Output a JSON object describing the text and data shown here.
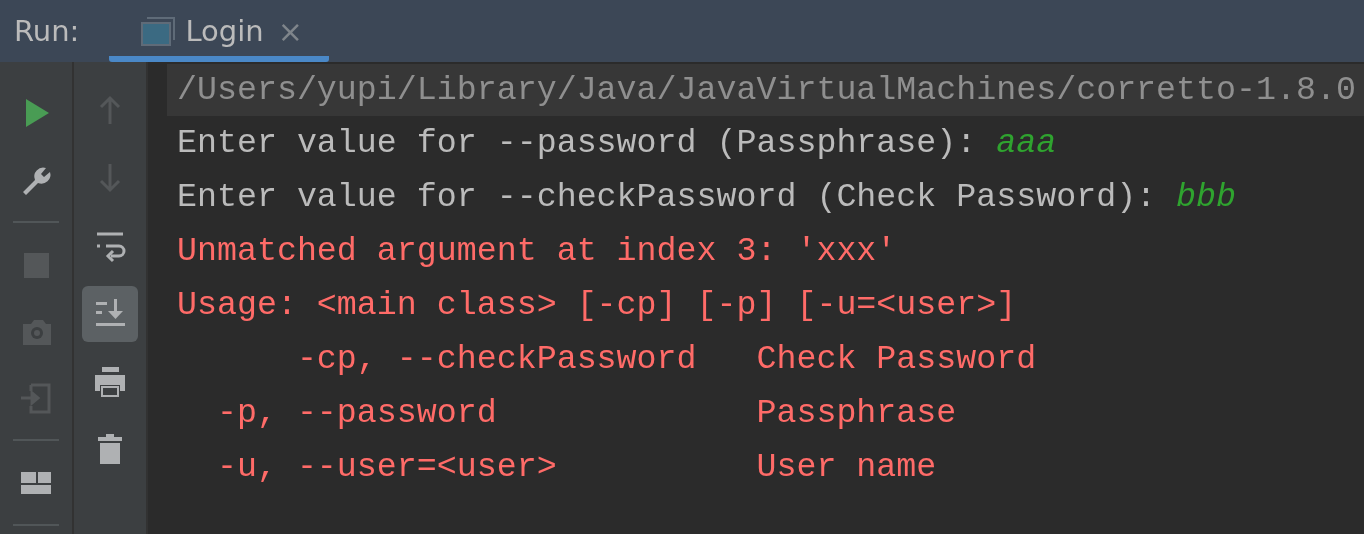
{
  "header": {
    "label": "Run:",
    "tabs": [
      {
        "title": "Login",
        "close": "×",
        "selected": true
      }
    ]
  },
  "left_toolbar": [
    {
      "kind": "run",
      "disabled": false
    },
    {
      "kind": "settings",
      "disabled": false
    },
    {
      "kind": "separator"
    },
    {
      "kind": "stop",
      "disabled": true
    },
    {
      "kind": "screenshot",
      "disabled": true
    },
    {
      "kind": "attach",
      "disabled": true
    },
    {
      "kind": "separator"
    },
    {
      "kind": "layout",
      "disabled": false
    },
    {
      "kind": "separator"
    }
  ],
  "right_toolbar": [
    {
      "kind": "up",
      "disabled": true,
      "selected": false
    },
    {
      "kind": "down",
      "disabled": true,
      "selected": false
    },
    {
      "kind": "wrap",
      "disabled": false,
      "selected": false
    },
    {
      "kind": "scroll-end",
      "disabled": false,
      "selected": true
    },
    {
      "kind": "print",
      "disabled": false,
      "selected": false
    },
    {
      "kind": "trash",
      "disabled": false,
      "selected": false
    }
  ],
  "console": [
    {
      "kind": "command",
      "text": "/Users/yupi/Library/Java/JavaVirtualMachines/corretto-1.8.0"
    },
    {
      "kind": "prompt",
      "text": "Enter value for --password (Passphrase): ",
      "input": "aaa"
    },
    {
      "kind": "prompt",
      "text": "Enter value for --checkPassword (Check Password): ",
      "input": "bbb"
    },
    {
      "kind": "error",
      "text": "Unmatched argument at index 3: 'xxx'"
    },
    {
      "kind": "error",
      "text": "Usage: <main class> [-cp] [-p] [-u=<user>]"
    },
    {
      "kind": "error",
      "text": "      -cp, --checkPassword   Check Password"
    },
    {
      "kind": "error",
      "text": "  -p, --password             Passphrase"
    },
    {
      "kind": "error",
      "text": "  -u, --user=<user>          User name"
    }
  ]
}
